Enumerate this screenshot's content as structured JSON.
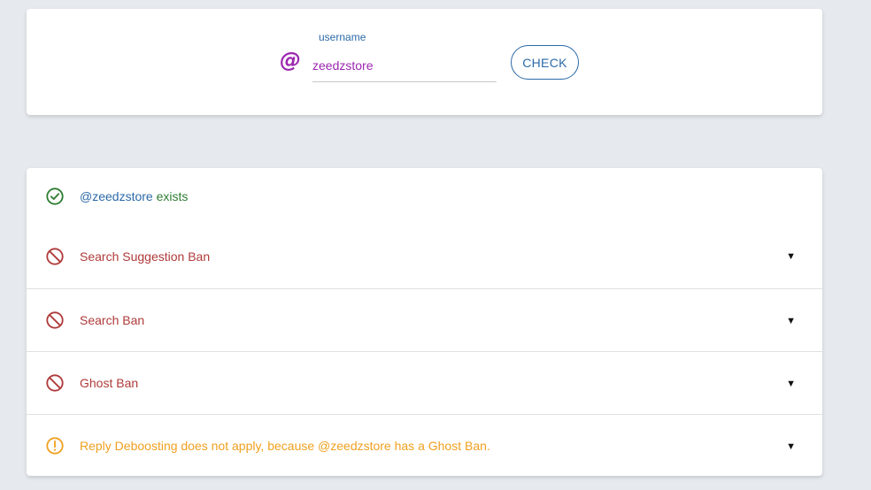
{
  "search": {
    "label": "username",
    "value": "zeedzstore",
    "at_symbol": "@",
    "check_label": "CHECK"
  },
  "results": {
    "exists": {
      "user": "@zeedzstore",
      "suffix": " exists",
      "icon": "check-circle-icon",
      "color": "#2e7d32"
    },
    "items": [
      {
        "label": "Search Suggestion Ban",
        "icon": "ban-icon",
        "color": "#b03a3a",
        "caret": "▼"
      },
      {
        "label": "Search Ban",
        "icon": "ban-icon",
        "color": "#b03a3a",
        "caret": "▼"
      },
      {
        "label": "Ghost Ban",
        "icon": "ban-icon",
        "color": "#b03a3a",
        "caret": "▼"
      },
      {
        "label": "Reply Deboosting does not apply, because @zeedzstore has a Ghost Ban.",
        "icon": "warning-circle-icon",
        "color": "#f0a020",
        "caret": "▼"
      }
    ]
  }
}
